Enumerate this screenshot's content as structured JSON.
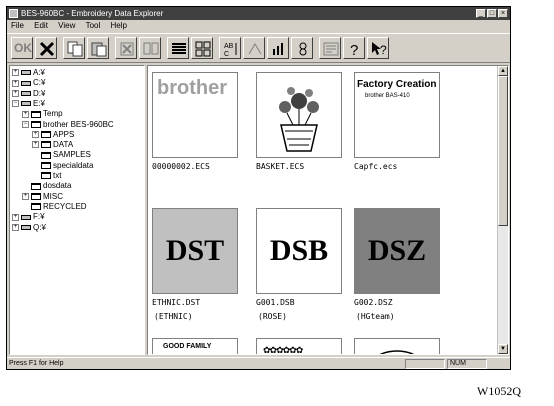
{
  "window": {
    "title": "BES-960BC - Embroidery Data Explorer",
    "controls": [
      "_",
      "□",
      "×"
    ]
  },
  "menu": [
    "File",
    "Edit",
    "View",
    "Tool",
    "Help"
  ],
  "toolbar": {
    "ok_label": "OK",
    "icons": [
      "ok-icon",
      "delete-icon",
      "copy-icon",
      "paste-icon",
      "cut-icon",
      "move-icon",
      "details-view-icon",
      "large-icons-view-icon",
      "sort-name-icon",
      "sort-size-icon",
      "sort-type-icon",
      "sort-date-icon",
      "preferences-icon",
      "help-icon",
      "context-help-icon"
    ],
    "sort_label": "AB C"
  },
  "tree": [
    {
      "label": "A:¥",
      "level": 0,
      "type": "drive",
      "toggle": "+"
    },
    {
      "label": "C:¥",
      "level": 0,
      "type": "drive",
      "toggle": "+"
    },
    {
      "label": "D:¥",
      "level": 0,
      "type": "drive",
      "toggle": "+"
    },
    {
      "label": "E:¥",
      "level": 0,
      "type": "drive",
      "toggle": "-"
    },
    {
      "label": "Temp",
      "level": 1,
      "type": "folder",
      "toggle": "+"
    },
    {
      "label": "brother BES-960BC",
      "level": 1,
      "type": "folder",
      "toggle": "-"
    },
    {
      "label": "APPS",
      "level": 2,
      "type": "folder",
      "toggle": "+"
    },
    {
      "label": "DATA",
      "level": 2,
      "type": "folder",
      "toggle": "+"
    },
    {
      "label": "SAMPLES",
      "level": 2,
      "type": "folder",
      "toggle": ""
    },
    {
      "label": "specialdata",
      "level": 2,
      "type": "folder",
      "toggle": ""
    },
    {
      "label": "txt",
      "level": 2,
      "type": "folder",
      "toggle": ""
    },
    {
      "label": "dosdata",
      "level": 1,
      "type": "folder",
      "toggle": ""
    },
    {
      "label": "MISC",
      "level": 1,
      "type": "folder",
      "toggle": "+"
    },
    {
      "label": "RECYCLED",
      "level": 1,
      "type": "folder",
      "toggle": ""
    },
    {
      "label": "F:¥",
      "level": 0,
      "type": "drive",
      "toggle": "+"
    },
    {
      "label": "Q:¥",
      "level": 0,
      "type": "drive",
      "toggle": "+"
    }
  ],
  "files": [
    {
      "name": "00000002.ECS",
      "sub": "",
      "thumb_text": "brother",
      "bg": "#ffffff"
    },
    {
      "name": "BASKET.ECS",
      "sub": "",
      "thumb_text": "",
      "bg": "#ffffff"
    },
    {
      "name": "Capfc.ecs",
      "sub": "",
      "thumb_text": "Factory Creation",
      "thumb_text2": "brother BAS-410",
      "bg": "#ffffff"
    },
    {
      "name": "ETHNIC.DST",
      "sub": "(ETHNIC)",
      "thumb_text": "DST",
      "bg": "#c0c0c0"
    },
    {
      "name": "G001.DSB",
      "sub": "(ROSE)",
      "thumb_text": "DSB",
      "bg": "#ffffff"
    },
    {
      "name": "G002.DSZ",
      "sub": "(HGteam)",
      "thumb_text": "DSZ",
      "bg": "#808080"
    },
    {
      "name": "",
      "sub": "",
      "thumb_text": "GOOD FAMILY",
      "bg": "#ffffff"
    },
    {
      "name": "",
      "sub": "",
      "thumb_text": "",
      "bg": "#ffffff"
    },
    {
      "name": "",
      "sub": "",
      "thumb_text": "",
      "bg": "#ffffff"
    }
  ],
  "status": {
    "help_text": "Press F1 for Help",
    "num": "NUM"
  },
  "figure_code": "W1052Q"
}
